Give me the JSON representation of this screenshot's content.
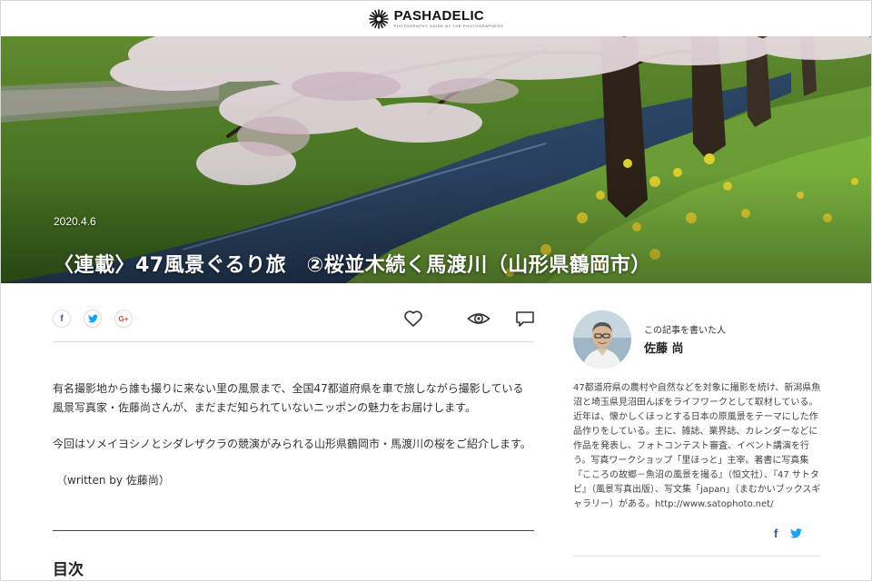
{
  "site": {
    "name": "PASHADELIC",
    "tagline": "PHOTOGRAPHY GUIDE BY THE PHOTOGRAPHERS"
  },
  "hero": {
    "date": "2020.4.6",
    "title": "〈連載〉47風景ぐるり旅　②桜並木続く馬渡川（山形県鶴岡市）"
  },
  "share": {
    "facebook_icon": "f",
    "twitter_icon": "twitter-bird",
    "googleplus_icon": "G+",
    "actions": [
      "heart-icon",
      "eye-icon",
      "comment-icon"
    ]
  },
  "article": {
    "intro": "有名撮影地から誰も撮りに来ない里の風景まで、全国47都道府県を車で旅しながら撮影している風景写真家・佐藤尚さんが、まだまだ知られていないニッポンの魅力をお届けします。",
    "lead": "今回はソメイヨシノとシダレザクラの競演がみられる山形県鶴岡市・馬渡川の桜をご紹介します。",
    "credit": "（written by 佐藤尚）",
    "toc_heading": "目次"
  },
  "author": {
    "caption": "この記事を書いた人",
    "name": "佐藤 尚",
    "bio": "47都道府県の農村や自然などを対象に撮影を続け、新潟県魚沼と埼玉県見沼田んぼをライフワークとして取材している。近年は、懐かしくほっとする日本の原風景をテーマにした作品作りをしている。主に、雑誌、業界誌、カレンダーなどに作品を発表し、フォトコンテスト審査、イベント講演を行う。写真ワークショップ「里ほっと」主宰。著書に写真集『こころの故郷－魚沼の風景を撮る』（恒文社）、『47 サトタビ』（風景写真出版）、写文集「japan」（まむかいブックスギャラリー）がある。http://www.satophoto.net/",
    "social": [
      "f",
      "twitter-bird"
    ]
  },
  "colors": {
    "facebook": "#3b5998",
    "twitter": "#1da1f2",
    "googleplus": "#dd4b39",
    "text": "#333333"
  }
}
